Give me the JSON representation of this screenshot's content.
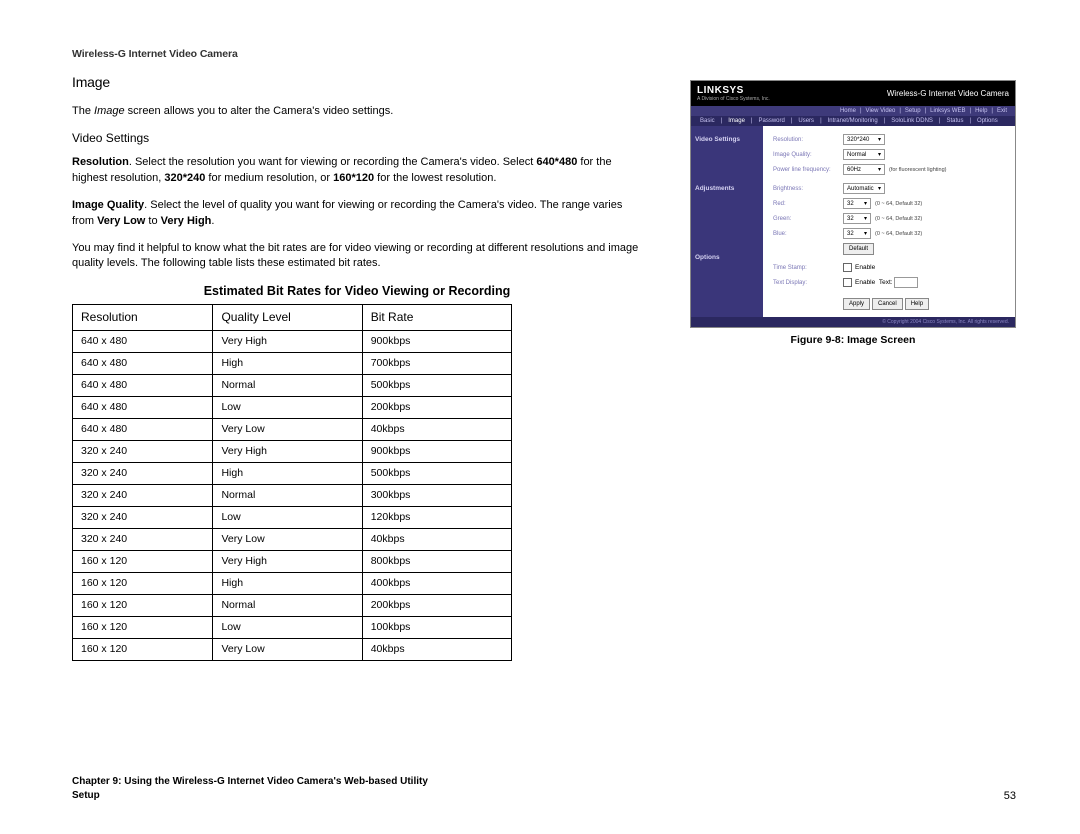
{
  "header": {
    "title": "Wireless-G Internet Video Camera"
  },
  "section": {
    "title": "Image",
    "intro_pre": "The ",
    "intro_em": "Image",
    "intro_post": " screen allows you to alter the Camera's video settings.",
    "sub": "Video Settings",
    "p1_b1": "Resolution",
    "p1_t1": ". Select the resolution you want for viewing or recording the Camera's video. Select ",
    "p1_b2": "640*480",
    "p1_t2": " for the highest resolution, ",
    "p1_b3": "320*240",
    "p1_t3": " for medium resolution, or ",
    "p1_b4": "160*120",
    "p1_t4": " for the lowest resolution.",
    "p2_b1": "Image Quality",
    "p2_t1": ". Select the level of quality you want for viewing or recording the Camera's video. The range varies from ",
    "p2_b2": "Very Low",
    "p2_t2": " to ",
    "p2_b3": "Very High",
    "p2_t3": ".",
    "p3": "You may find it helpful to know what the bit rates are for video viewing or recording at different resolutions and image quality levels. The following table lists these estimated bit rates."
  },
  "table": {
    "title": "Estimated Bit Rates for Video Viewing or Recording",
    "head": {
      "c1": "Resolution",
      "c2": "Quality Level",
      "c3": "Bit Rate"
    },
    "rows": [
      {
        "res": "640 x 480",
        "q": "Very High",
        "br": "900kbps"
      },
      {
        "res": "640 x 480",
        "q": "High",
        "br": "700kbps"
      },
      {
        "res": "640 x 480",
        "q": "Normal",
        "br": "500kbps"
      },
      {
        "res": "640 x 480",
        "q": "Low",
        "br": "200kbps"
      },
      {
        "res": "640 x 480",
        "q": "Very Low",
        "br": "40kbps"
      },
      {
        "res": "320 x 240",
        "q": "Very High",
        "br": "900kbps"
      },
      {
        "res": "320 x 240",
        "q": "High",
        "br": "500kbps"
      },
      {
        "res": "320 x 240",
        "q": "Normal",
        "br": "300kbps"
      },
      {
        "res": "320 x 240",
        "q": "Low",
        "br": "120kbps"
      },
      {
        "res": "320 x 240",
        "q": "Very Low",
        "br": "40kbps"
      },
      {
        "res": "160 x 120",
        "q": "Very High",
        "br": "800kbps"
      },
      {
        "res": "160 x 120",
        "q": "High",
        "br": "400kbps"
      },
      {
        "res": "160 x 120",
        "q": "Normal",
        "br": "200kbps"
      },
      {
        "res": "160 x 120",
        "q": "Low",
        "br": "100kbps"
      },
      {
        "res": "160 x 120",
        "q": "Very Low",
        "br": "40kbps"
      }
    ]
  },
  "figure": {
    "caption": "Figure 9-8: Image Screen"
  },
  "screenshot": {
    "brand": "LINKSYS",
    "subbrand": "A Division of Cisco Systems, Inc.",
    "product": "Wireless-G Internet Video Camera",
    "nav1": [
      "Home",
      "View Video",
      "Setup",
      "Linksys WEB",
      "Help",
      "Exit"
    ],
    "nav2": [
      "Basic",
      "Image",
      "Password",
      "Users",
      "Intranet/Monitoring",
      "SoloLink DDNS",
      "Status",
      "Options"
    ],
    "groups": {
      "g1": "Video Settings",
      "g2": "Adjustments",
      "g3": "Options"
    },
    "labels": {
      "resolution": "Resolution:",
      "imgq": "Image Quality:",
      "plf": "Power line frequency:",
      "brightness": "Brightness:",
      "red": "Red:",
      "green": "Green:",
      "blue": "Blue:",
      "ts": "Time Stamp:",
      "td": "Text Display:"
    },
    "vals": {
      "resolution": "320*240",
      "imgq": "Normal",
      "plf": "60Hz",
      "brightness": "Automatic",
      "rgb": "32",
      "rgbnote": "(0 ~ 64, Default 32)",
      "plfnote": "(for fluorescent lighting)"
    },
    "enable": "Enable",
    "text": "Text:",
    "btn_default": "Default",
    "btn_apply": "Apply",
    "btn_cancel": "Cancel",
    "btn_help": "Help",
    "copyright": "© Copyright 2004 Cisco Systems, Inc. All rights reserved."
  },
  "footer": {
    "left1": "Chapter 9: Using the Wireless-G Internet Video Camera's Web-based Utility",
    "left2": "Setup",
    "pagenum": "53"
  }
}
